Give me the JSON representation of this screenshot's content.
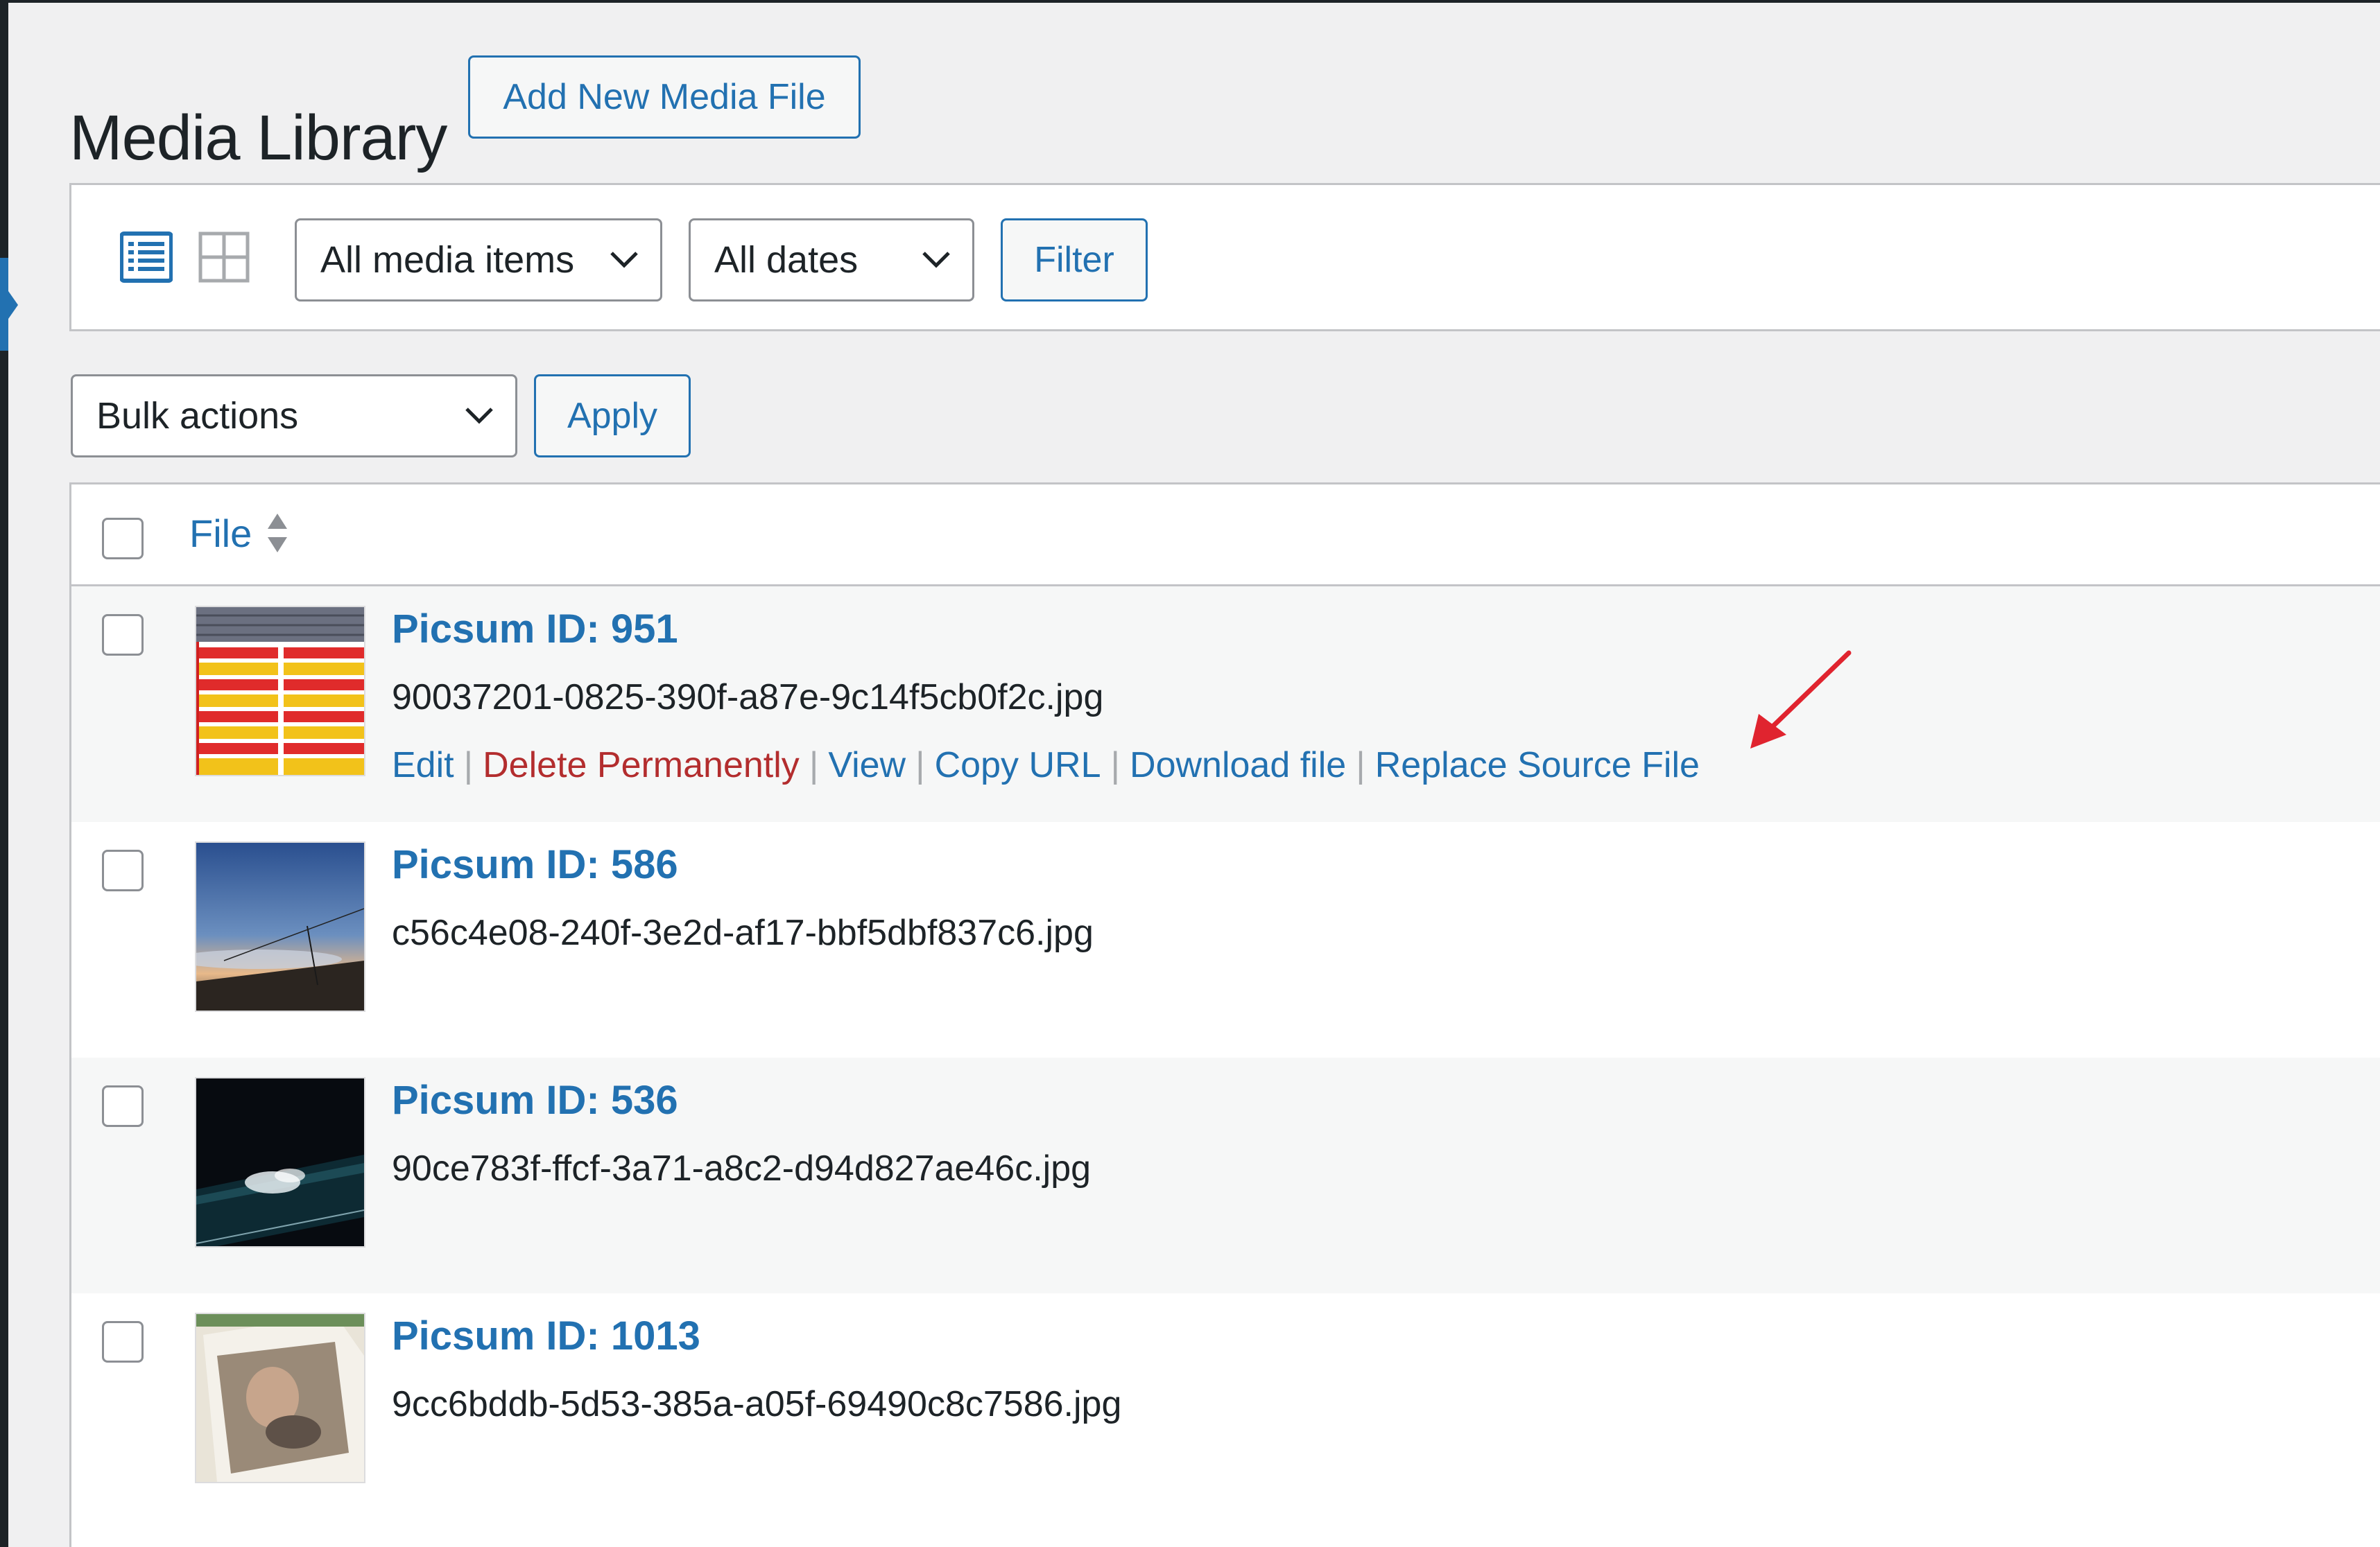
{
  "page": {
    "title": "Media Library",
    "add_new_label": "Add New Media File"
  },
  "filters": {
    "view_list_icon": "list-view-icon",
    "view_grid_icon": "grid-view-icon",
    "media_type": "All media items",
    "dates": "All dates",
    "filter_label": "Filter"
  },
  "bulk": {
    "selected": "Bulk actions",
    "apply_label": "Apply"
  },
  "table": {
    "columns": [
      "File"
    ],
    "rows": [
      {
        "title": "Picsum ID: 951",
        "filename": "90037201-0825-390f-a87e-9c14f5cb0f2c.jpg",
        "actions": {
          "edit": "Edit",
          "delete": "Delete Permanently",
          "view": "View",
          "copy_url": "Copy URL",
          "download": "Download file",
          "replace": "Replace Source File"
        }
      },
      {
        "title": "Picsum ID: 586",
        "filename": "c56c4e08-240f-3e2d-af17-bbf5dbf837c6.jpg"
      },
      {
        "title": "Picsum ID: 536",
        "filename": "90ce783f-ffcf-3a71-a8c2-d94d827ae46c.jpg"
      },
      {
        "title": "Picsum ID: 1013",
        "filename": "9cc6bddb-5d53-385a-a05f-69490c8c7586.jpg"
      }
    ]
  },
  "colors": {
    "link": "#2271b1",
    "delete": "#b32d2e",
    "annotation_arrow": "#e0242f"
  }
}
